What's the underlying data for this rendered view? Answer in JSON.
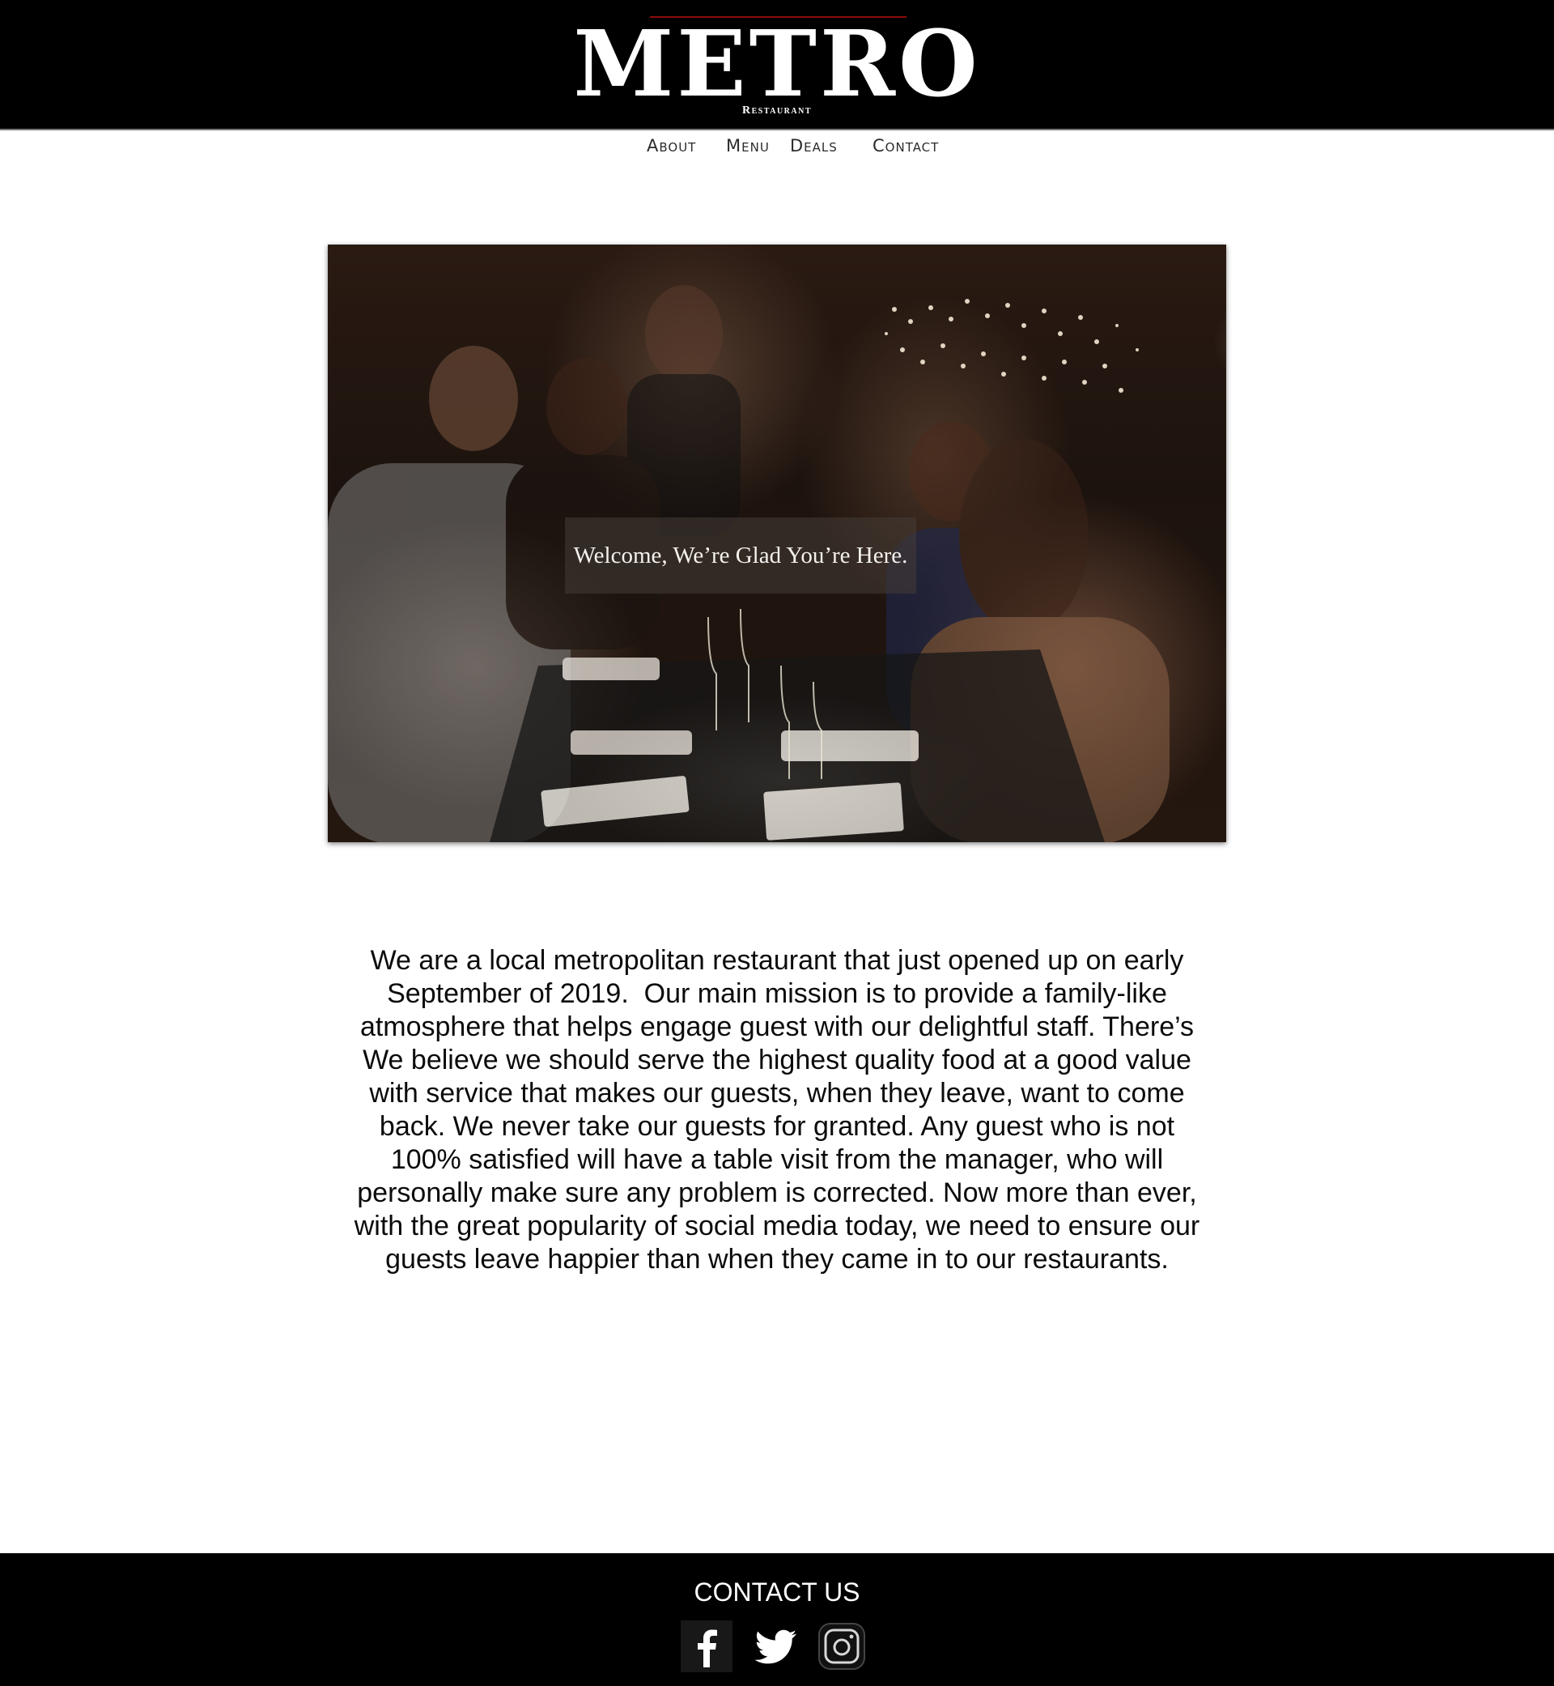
{
  "header": {
    "logo_text": "METRO",
    "logo_subtitle": "Restaurant"
  },
  "nav": {
    "items": [
      "About",
      "Menu",
      "Deals",
      "Contact"
    ]
  },
  "hero": {
    "caption": "Welcome, We’re Glad You’re Here."
  },
  "about": {
    "lines": [
      "We are a local metropolitan restaurant that just opened up on early",
      "September of 2019.  Our main mission is to provide a family-like",
      "atmosphere that helps engage guest with our delightful staff. There’s",
      "We believe we should serve the highest quality food at a good value",
      "with service that makes our guests, when they leave, want to come",
      "back. We never take our guests for granted. Any guest who is not",
      "100% satisfied will have a table visit from the manager, who will",
      "personally make sure any problem is corrected. Now more than ever,",
      "with the great popularity of social media today, we need to ensure our",
      "guests leave happier than when they came in to our restaurants."
    ]
  },
  "footer": {
    "title": "CONTACT US",
    "social": [
      {
        "icon": "facebook-icon"
      },
      {
        "icon": "twitter-icon"
      },
      {
        "icon": "instagram-icon"
      }
    ]
  },
  "colors": {
    "header_bg": "#000000",
    "accent_line": "#8b0d0d",
    "footer_bg": "#000000"
  }
}
